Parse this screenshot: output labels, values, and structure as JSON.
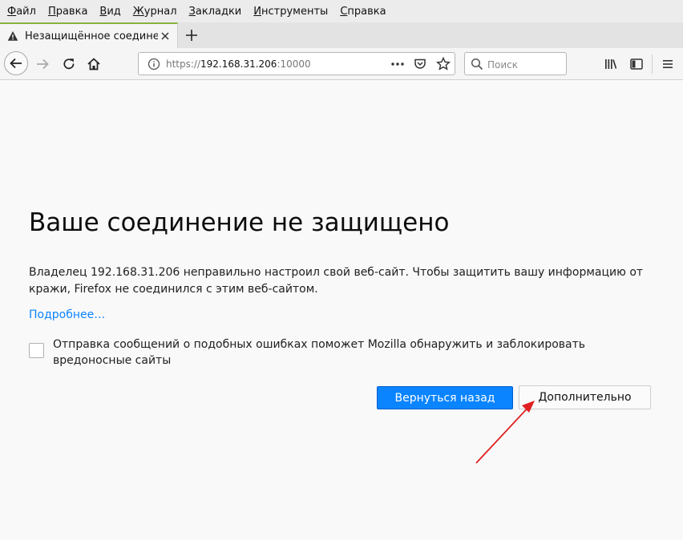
{
  "menubar": {
    "items": [
      "Файл",
      "Правка",
      "Вид",
      "Журнал",
      "Закладки",
      "Инструменты",
      "Справка"
    ]
  },
  "tab": {
    "title": "Незащищённое соединение",
    "new_tab_symbol": "+"
  },
  "navbar": {
    "url_scheme": "https://",
    "url_host": "192.168.31.206",
    "url_port": ":10000",
    "search_placeholder": "Поиск"
  },
  "page": {
    "heading": "Ваше соединение не защищено",
    "description": "Владелец 192.168.31.206 неправильно настроил свой веб-сайт. Чтобы защитить вашу информацию от кражи, Firefox не соединился с этим веб-сайтом.",
    "learn_more": "Подробнее…",
    "report_checkbox_label": "Отправка сообщений о подобных ошибках поможет Mozilla обнаружить и заблокировать вредоносные сайты",
    "report_checked": false,
    "go_back_button": "Вернуться назад",
    "advanced_button": "Дополнительно"
  },
  "colors": {
    "primary_button": "#0a84ff",
    "link": "#0a84ff",
    "annotation_arrow": "#e02020"
  }
}
